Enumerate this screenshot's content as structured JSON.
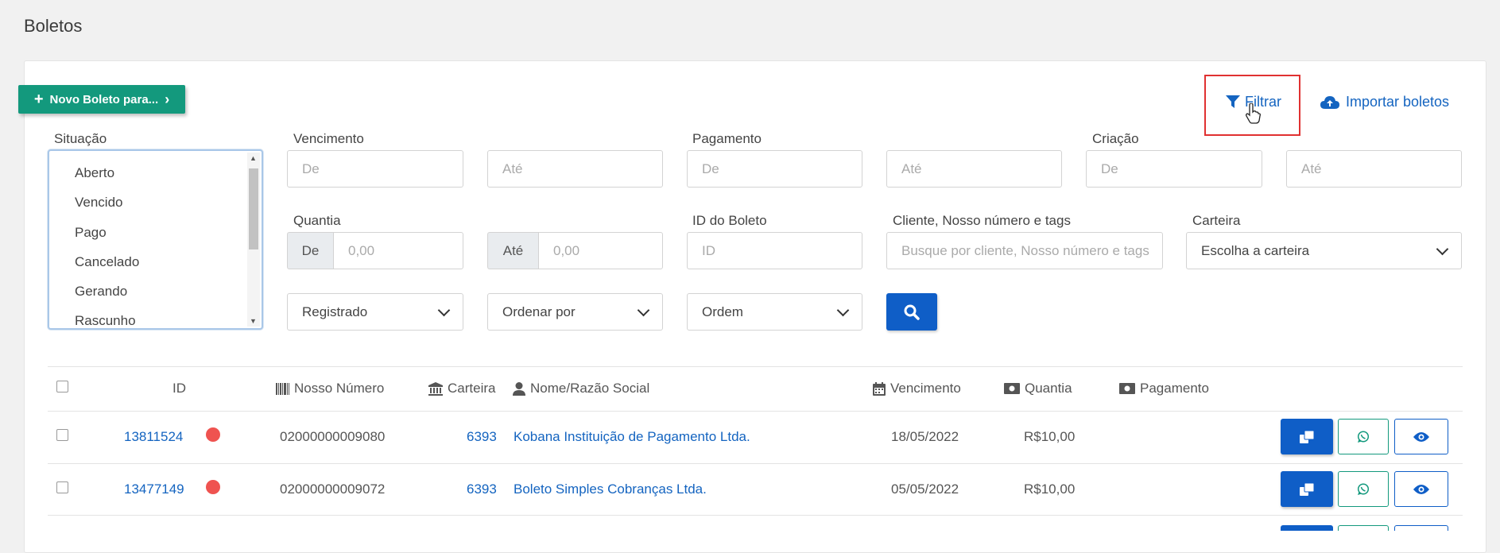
{
  "page": {
    "title": "Boletos"
  },
  "toolbar": {
    "new_boleto_label": "Novo Boleto para...",
    "filter_label": "Filtrar",
    "import_label": "Importar boletos"
  },
  "filters": {
    "situacao": {
      "label": "Situação",
      "options": [
        "Aberto",
        "Vencido",
        "Pago",
        "Cancelado",
        "Gerando",
        "Rascunho"
      ]
    },
    "vencimento": {
      "label": "Vencimento",
      "from_placeholder": "De",
      "to_placeholder": "Até"
    },
    "pagamento": {
      "label": "Pagamento",
      "from_placeholder": "De",
      "to_placeholder": "Até"
    },
    "criacao": {
      "label": "Criação",
      "from_placeholder": "De",
      "to_placeholder": "Até"
    },
    "quantia": {
      "label": "Quantia",
      "from_addon": "De",
      "from_placeholder": "0,00",
      "to_addon": "Até",
      "to_placeholder": "0,00"
    },
    "id_boleto": {
      "label": "ID do Boleto",
      "placeholder": "ID"
    },
    "cliente": {
      "label": "Cliente, Nosso número e tags",
      "placeholder": "Busque por cliente, Nosso número e tags"
    },
    "carteira": {
      "label": "Carteira",
      "value": "Escolha a carteira"
    },
    "registrado": {
      "value": "Registrado"
    },
    "ordenar_por": {
      "value": "Ordenar por"
    },
    "ordem": {
      "value": "Ordem"
    }
  },
  "table": {
    "headers": {
      "id": "ID",
      "nosso_numero": "Nosso Número",
      "carteira": "Carteira",
      "nome": "Nome/Razão Social",
      "vencimento": "Vencimento",
      "quantia": "Quantia",
      "pagamento": "Pagamento"
    },
    "rows": [
      {
        "id": "13811524",
        "status_color": "#ef5350",
        "nosso_numero": "02000000009080",
        "carteira": "6393",
        "nome": "Kobana Instituição de Pagamento Ltda.",
        "vencimento": "18/05/2022",
        "quantia": "R$10,00",
        "pagamento": ""
      },
      {
        "id": "13477149",
        "status_color": "#ef5350",
        "nosso_numero": "02000000009072",
        "carteira": "6393",
        "nome": "Boleto Simples Cobranças Ltda.",
        "vencimento": "05/05/2022",
        "quantia": "R$10,00",
        "pagamento": ""
      }
    ]
  },
  "icons": {
    "filter": "funnel-icon",
    "import": "cloud-upload-icon",
    "search": "search-icon",
    "copy": "copy-icon",
    "whatsapp": "whatsapp-icon",
    "view": "eye-icon"
  },
  "colors": {
    "primary": "#0f5ec7",
    "success": "#13997d",
    "link": "#1464c0",
    "danger": "#ef5350",
    "highlight_border": "#e03131"
  }
}
